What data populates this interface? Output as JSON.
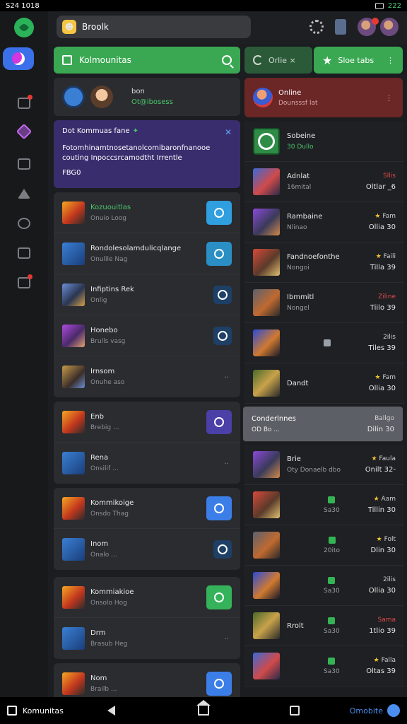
{
  "status_bar": {
    "time": "S24 1018",
    "right": "222"
  },
  "top_bar": {
    "search_text": "Broolk"
  },
  "left": {
    "header_title": "Kolmounitas",
    "profile": {
      "line1": "bon",
      "line2": "Ot@ibosess"
    },
    "banner": {
      "title": "Dot Kommuas fane",
      "body": "Fotomhinamtnosetanolcomibaronfnanooe couting Inpoccsrcamodtht Irrentle",
      "footer": "FBG0"
    },
    "group1": [
      {
        "title": "Kozuouitlas",
        "sub": "Onuio Loog",
        "title_green": true,
        "action_color": "#2f9fe0"
      },
      {
        "title": "Rondolesolamdulicqlange",
        "sub": "Onulile Nag",
        "action_color": "#2a8fc4"
      },
      {
        "title": "Infiptins Rek",
        "sub": "Onlig",
        "action_color": "#1e3f66"
      },
      {
        "title": "Honebo",
        "sub": "Brulls vasg",
        "action_color": "#1e3f66"
      },
      {
        "title": "Irnsom",
        "sub": "Onuhe aso",
        "action_color": ""
      }
    ],
    "group2": [
      {
        "title": "Enb",
        "sub": "Brebig ...",
        "action_color": "#4b3fa8"
      },
      {
        "title": "Rena",
        "sub": "Onsilif ...",
        "action_color": ""
      }
    ],
    "group3": [
      {
        "title": "Kommikoige",
        "sub": "Onsdo Thag",
        "action_color": "#3b7ee8"
      },
      {
        "title": "Inom",
        "sub": "Onalo ...",
        "action_color": "#1e3f66"
      }
    ],
    "group4": [
      {
        "title": "Kommiakioe",
        "sub": "Onsolo Hog",
        "action_color": "#35b35a"
      },
      {
        "title": "Drm",
        "sub": "Brasub Heg",
        "action_color": ""
      }
    ],
    "group5": [
      {
        "title": "Nom",
        "sub": "Brailb ...",
        "action_color": "#3b7ee8"
      }
    ]
  },
  "right": {
    "tab_online": "Orlie ×",
    "tab_store": "Sloe tabs",
    "alert": {
      "title": "Online",
      "sub": "Dounsssf lat"
    },
    "rows": [
      {
        "kind": "feature",
        "title": "Sobeine",
        "sub": "30 Dullo",
        "r1": "",
        "r2": ""
      },
      {
        "kind": "game",
        "title": "Adnlat",
        "sub": "16mital",
        "r1": "Sllis",
        "r1_red": true,
        "r2": "Oltlar _6"
      },
      {
        "kind": "game",
        "title": "Rambaine",
        "sub": "Nlinao",
        "r1": "Fam",
        "r1_star": true,
        "r2": "Ollia 30"
      },
      {
        "kind": "game",
        "title": "Fandnoefonthe",
        "sub": "Nongoi",
        "r1": "Faili",
        "r1_star": true,
        "r2": "Tilla 39"
      },
      {
        "kind": "game",
        "title": "Ibmmitl",
        "sub": "Nongel",
        "r1": "Ziline",
        "r1_red": true,
        "r2": "Tiilo 39"
      },
      {
        "kind": "game",
        "title": "",
        "sub": "",
        "r1": "2ilis",
        "r2": "Tiles 39",
        "mid": true
      },
      {
        "kind": "game",
        "title": "Dandt",
        "sub": "",
        "r1": "Fam",
        "r1_star": true,
        "r2": "Ollia 30"
      },
      {
        "kind": "highlight",
        "title": "Conderlnnes",
        "sub": "OD Bo ...",
        "r1": "Ballgo",
        "r2": "Dilin 30"
      },
      {
        "kind": "game",
        "title": "Brie",
        "sub": "Oty Donaelb dbo",
        "r1": "Faula",
        "r1_star": true,
        "r2": "Onilt 32-"
      },
      {
        "kind": "game",
        "title": "",
        "sub": "",
        "r1": "Aam",
        "r1_star": true,
        "r2": "Tillin 30",
        "mid": true,
        "mid_text": "Sa30"
      },
      {
        "kind": "game",
        "title": "",
        "sub": "",
        "r1": "Folt",
        "r1_star": true,
        "r2": "Dlin 30",
        "mid": true,
        "mid_text": "20ito"
      },
      {
        "kind": "game",
        "title": "",
        "sub": "",
        "r1": "2ilis",
        "r2": "Ollia 30",
        "mid": true,
        "mid_text": "Sa30"
      },
      {
        "kind": "game",
        "title": "Rrolt",
        "sub": "",
        "r1": "Sama",
        "r1_red": true,
        "r2": "1tlio 39",
        "mid": true,
        "mid_text": "Sa30"
      },
      {
        "kind": "game",
        "title": "",
        "sub": "",
        "r1": "Falla",
        "r1_star": true,
        "r2": "Oltas 39",
        "mid": true,
        "mid_text": "Sa30"
      }
    ]
  },
  "bottom_nav": {
    "app_label": "Komunitas",
    "right_label": "Omobite"
  }
}
